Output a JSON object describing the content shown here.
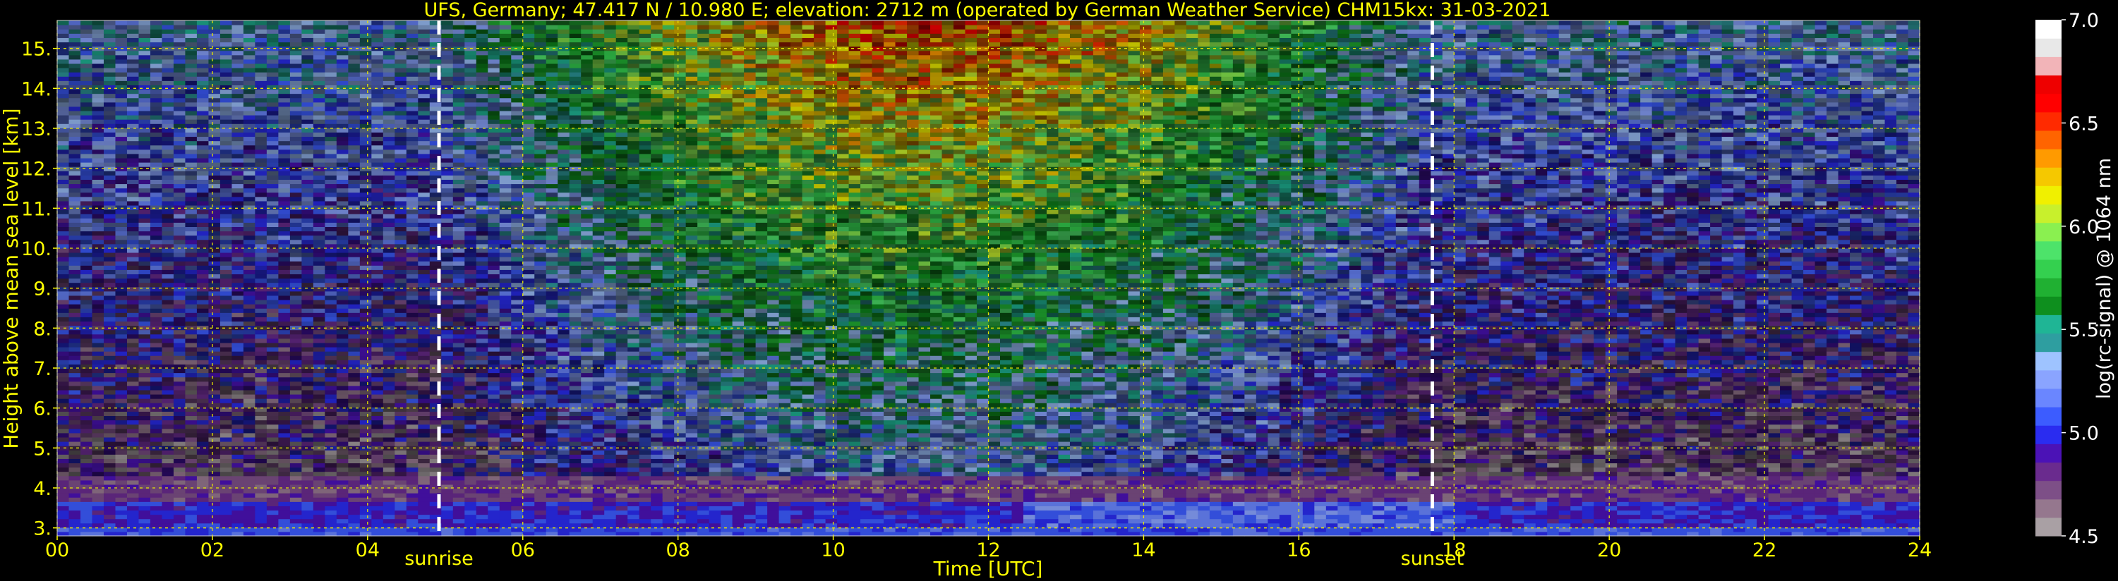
{
  "chart_data": {
    "type": "heatmap",
    "title": "UFS, Germany; 47.417 N / 10.980 E; elevation: 2712 m  (operated by German Weather Service)    CHM15kx: 31-03-2021",
    "xlabel": "Time [UTC]",
    "ylabel": "Height above mean sea level [km]",
    "colorbar_label": "log(rc-signal) @ 1064 nm",
    "xlim": [
      0,
      24
    ],
    "ylim": [
      2.8,
      15.7
    ],
    "xticks": [
      "00",
      "02",
      "04",
      "06",
      "08",
      "10",
      "12",
      "14",
      "16",
      "18",
      "20",
      "22",
      "24"
    ],
    "yticks": [
      "3.",
      "4.",
      "5.",
      "6.",
      "7.",
      "8.",
      "9.",
      "10.",
      "11.",
      "12.",
      "13.",
      "14.",
      "15."
    ],
    "colorbar_range": [
      4.5,
      7.0
    ],
    "colorbar_ticks": [
      "4.5",
      "5.0",
      "5.5",
      "6.0",
      "6.5",
      "7.0"
    ],
    "grid": true,
    "markers": [
      {
        "label": "sunrise",
        "time": 4.92
      },
      {
        "label": "sunset",
        "time": 17.72
      }
    ],
    "colorbar_colors": [
      "#a9a0a4",
      "#95778e",
      "#7d4f87",
      "#6a2b8e",
      "#4b12b6",
      "#2a2cf0",
      "#3c5cff",
      "#6a86ff",
      "#8aa4ff",
      "#9ec3ff",
      "#2e9ea0",
      "#1fb595",
      "#0e8f1e",
      "#20b032",
      "#34d04f",
      "#4de36a",
      "#8af050",
      "#c8f02c",
      "#f0f000",
      "#f5c800",
      "#ff9a00",
      "#ff6400",
      "#ff2a00",
      "#ff0000",
      "#ee0000",
      "#f2b4b8",
      "#e8e8e8",
      "#ffffff"
    ]
  }
}
